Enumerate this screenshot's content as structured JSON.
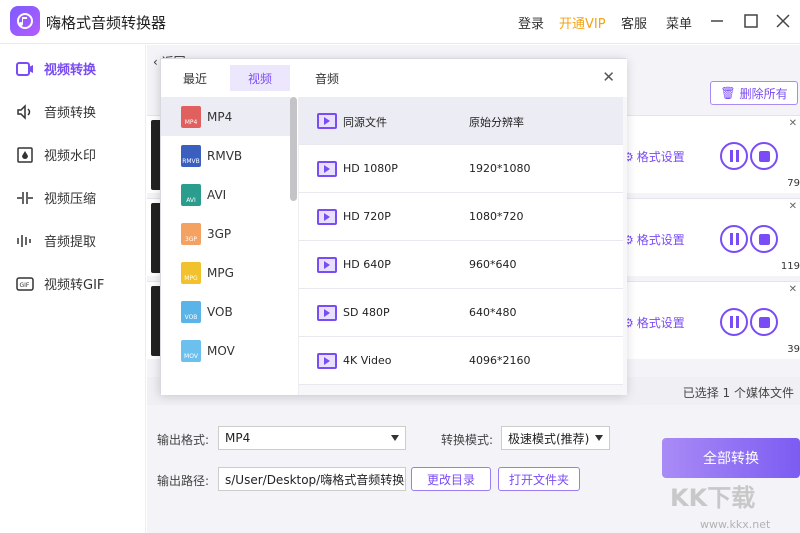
{
  "app": {
    "title": "嗨格式音频转换器"
  },
  "titlebar": {
    "login": "登录",
    "vip": "开通VIP",
    "service": "客服",
    "menu": "菜单"
  },
  "sidebar": {
    "items": [
      {
        "label": "视频转换",
        "icon": "video-convert-icon",
        "active": true
      },
      {
        "label": "音频转换",
        "icon": "audio-convert-icon"
      },
      {
        "label": "视频水印",
        "icon": "watermark-icon"
      },
      {
        "label": "视频压缩",
        "icon": "compress-icon"
      },
      {
        "label": "音频提取",
        "icon": "audio-extract-icon"
      },
      {
        "label": "视频转GIF",
        "icon": "gif-icon"
      }
    ]
  },
  "main": {
    "back": "返回",
    "delete_all": "删除所有",
    "tasks": [
      {
        "format_settings": "格式设置",
        "progress": "79"
      },
      {
        "format_settings": "格式设置",
        "progress": "119"
      },
      {
        "format_settings": "格式设置",
        "progress": "39"
      }
    ],
    "status": "已选择 1 个媒体文件"
  },
  "bottom": {
    "output_format_label": "输出格式:",
    "output_format_value": "MP4",
    "convert_mode_label": "转换模式:",
    "convert_mode_value": "极速模式(推荐)",
    "output_path_label": "输出路径:",
    "output_path_value": "s/User/Desktop/嗨格式音频转换器",
    "change_dir": "更改目录",
    "open_folder": "打开文件夹",
    "convert_all": "全部转换"
  },
  "dialog": {
    "tabs": [
      "最近",
      "视频",
      "音频"
    ],
    "active_tab": "视频",
    "formats": [
      {
        "name": "MP4",
        "color": "#e06060",
        "tag": "MP4"
      },
      {
        "name": "RMVB",
        "color": "#3a5fbf",
        "tag": "RMVB"
      },
      {
        "name": "AVI",
        "color": "#2a9d8f",
        "tag": "AVI"
      },
      {
        "name": "3GP",
        "color": "#f4a261",
        "tag": "3GP"
      },
      {
        "name": "MPG",
        "color": "#f2c12e",
        "tag": "MPG"
      },
      {
        "name": "VOB",
        "color": "#5ab4e8",
        "tag": "VOB"
      },
      {
        "name": "MOV",
        "color": "#6cc0ee",
        "tag": "MOV"
      }
    ],
    "resolutions": [
      {
        "name": "同源文件",
        "value": "原始分辨率"
      },
      {
        "name": "HD 1080P",
        "value": "1920*1080"
      },
      {
        "name": "HD 720P",
        "value": "1080*720"
      },
      {
        "name": "HD 640P",
        "value": "960*640"
      },
      {
        "name": "SD 480P",
        "value": "640*480"
      },
      {
        "name": "4K Video",
        "value": "4096*2160"
      }
    ]
  },
  "watermark": {
    "logo": "KK下载",
    "url": "www.kkx.net"
  }
}
